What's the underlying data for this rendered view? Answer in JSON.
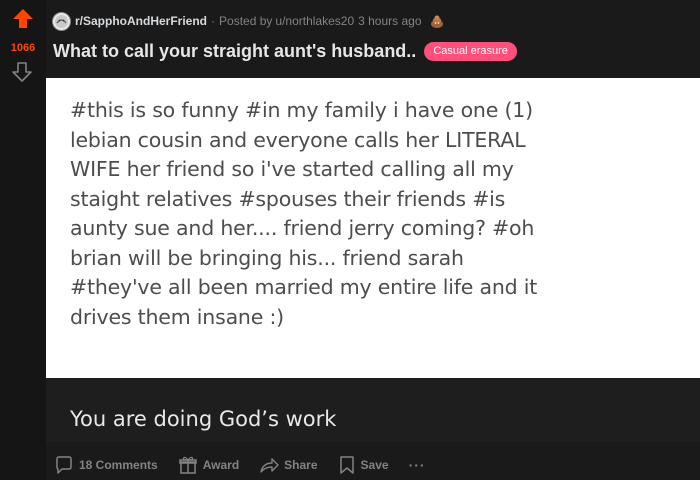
{
  "vote": {
    "score": "1066"
  },
  "meta": {
    "subreddit": "r/SapphoAndHerFriend",
    "separator": "·",
    "posted_by_label": "Posted by",
    "author": "u/northlakes20",
    "time": "3 hours ago"
  },
  "post": {
    "title": "What to call your straight aunt's husband..",
    "flair": "Casual erasure",
    "flair_color": "#ff4f7b",
    "image_lines": [
      "#this is so funny  #in my family i have one (1)",
      "lebian cousin and everyone calls her LITERAL",
      "WIFE her friend so i've started calling all my",
      "staight relatives  #spouses their friends  #is",
      "aunty sue and her.... friend jerry coming?  #oh",
      "brian will be bringing his... friend sarah",
      "#they've all been married my entire life and it",
      "drives them insane :)"
    ],
    "image_comment": "You are doing God’s work"
  },
  "actions": {
    "comments": "18 Comments",
    "award": "Award",
    "share": "Share",
    "save": "Save",
    "more": "···"
  },
  "colors": {
    "upvote_active": "#ff4500",
    "background": "#1a1a1b",
    "muted_text": "#818384"
  }
}
